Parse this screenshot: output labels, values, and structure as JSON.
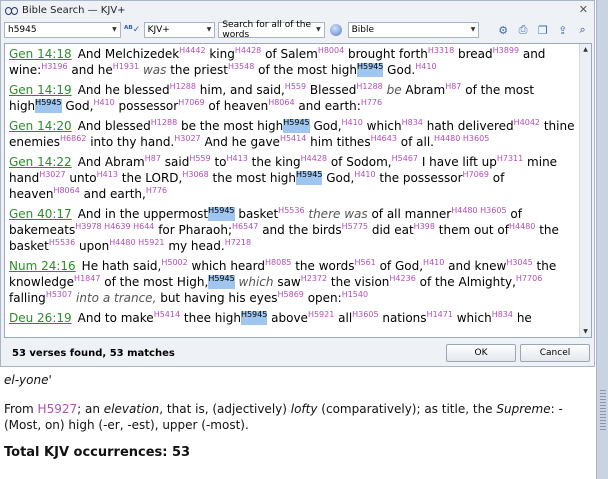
{
  "window": {
    "title": "Bible Search — KJV+",
    "close_glyph": "✕"
  },
  "toolbar": {
    "search_value": "h5945",
    "version": "KJV+",
    "search_mode": "Search for all of the words",
    "scope": "Bible"
  },
  "verses": [
    {
      "ref": "Gen 14:18",
      "html": "And Melchizedek<span class='sn'>H4442</span> king<span class='sn'>H4428</span> of Salem<span class='sn'>H8004</span> brought forth<span class='sn'>H3318</span> bread<span class='sn'>H3899</span> and wine:<span class='sn'>H3196</span> and he<span class='sn'>H1931</span> <em>was</em> the priest<span class='sn'>H3548</span> of the most high<span class='hl'><span class='sn'>H5945</span></span> God.<span class='sn'>H410</span>"
    },
    {
      "ref": "Gen 14:19",
      "html": "And he blessed<span class='sn'>H1288</span> him, and said,<span class='sn'>H559</span> Blessed<span class='sn'>H1288</span> <em>be</em> Abram<span class='sn'>H87</span> of the most high<span class='hl'><span class='sn'>H5945</span></span> God,<span class='sn'>H410</span> possessor<span class='sn'>H7069</span> of heaven<span class='sn'>H8064</span> and earth:<span class='sn'>H776</span>"
    },
    {
      "ref": "Gen 14:20",
      "html": "And blessed<span class='sn'>H1288</span> be the most high<span class='hl'><span class='sn'>H5945</span></span> God,<span class='sn'>H410</span> which<span class='sn'>H834</span> hath delivered<span class='sn'>H4042</span> thine enemies<span class='sn'>H6862</span> into thy hand.<span class='sn'>H3027</span> And he gave<span class='sn'>H5414</span> him tithes<span class='sn'>H4643</span> of all.<span class='sn'>H4480 H3605</span>"
    },
    {
      "ref": "Gen 14:22",
      "html": "And Abram<span class='sn'>H87</span> said<span class='sn'>H559</span> to<span class='sn'>H413</span> the king<span class='sn'>H4428</span> of Sodom,<span class='sn'>H5467</span> I have lift up<span class='sn'>H7311</span> mine hand<span class='sn'>H3027</span> unto<span class='sn'>H413</span> the LORD,<span class='sn'>H3068</span> the most high<span class='hl'><span class='sn'>H5945</span></span> God,<span class='sn'>H410</span> the possessor<span class='sn'>H7069</span> of heaven<span class='sn'>H8064</span> and earth,<span class='sn'>H776</span>"
    },
    {
      "ref": "Gen 40:17",
      "html": "And in the uppermost<span class='hl'><span class='sn'>H5945</span></span> basket<span class='sn'>H5536</span> <em>there was</em> of all manner<span class='sn'>H4480 H3605</span> of bakemeats<span class='sn'>H3978 H4639 H644</span> for Pharaoh;<span class='sn'>H6547</span> and the birds<span class='sn'>H5775</span> did eat<span class='sn'>H398</span> them out of<span class='sn'>H4480</span> the basket<span class='sn'>H5536</span> upon<span class='sn'>H4480 H5921</span> my head.<span class='sn'>H7218</span>"
    },
    {
      "ref": "Num 24:16",
      "html": "He hath said,<span class='sn'>H5002</span> which heard<span class='sn'>H8085</span> the words<span class='sn'>H561</span> of God,<span class='sn'>H410</span> and knew<span class='sn'>H3045</span> the knowledge<span class='sn'>H1847</span> of the most High,<span class='hl'><span class='sn'>H5945</span></span> <em>which</em> saw<span class='sn'>H2372</span> the vision<span class='sn'>H4236</span> of the Almighty,<span class='sn'>H7706</span> falling<span class='sn'>H5307</span> <em>into a trance,</em> but having his eyes<span class='sn'>H5869</span> open:<span class='sn'>H1540</span>"
    },
    {
      "ref": "Deu 26:19",
      "html": "And to make<span class='sn'>H5414</span> thee high<span class='hl'><span class='sn'>H5945</span></span> above<span class='sn'>H5921</span> all<span class='sn'>H3605</span> nations<span class='sn'>H1471</span> which<span class='sn'>H834</span> he"
    }
  ],
  "status": {
    "summary": "53 verses found, 53 matches",
    "ok_label": "OK",
    "cancel_label": "Cancel"
  },
  "lexicon": {
    "transliteration": "el-yone'",
    "from_prefix": "From ",
    "from_link": "H5927",
    "definition_html": "; an <i>elevation</i>, that is, (adjectively) <i>lofty</i> (comparatively); as title, the <i>Supreme</i>: - (Most, on) high (-er, -est), upper (-most).",
    "occurrences": "Total KJV occurrences: 53"
  },
  "colors": {
    "strongs": "#b34fb6",
    "reference": "#2a8f2a",
    "highlight": "#9ec6ee"
  }
}
